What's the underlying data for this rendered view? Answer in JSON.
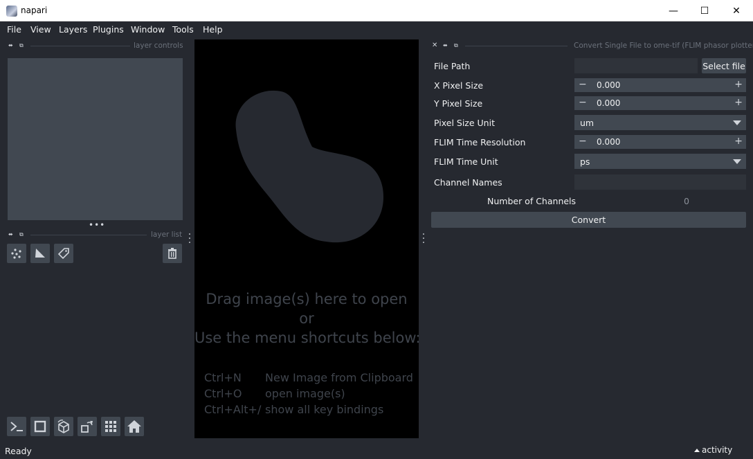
{
  "window": {
    "title": "napari",
    "min_glyph": "—",
    "max_glyph": "☐",
    "close_glyph": "✕"
  },
  "menu": [
    "File",
    "View",
    "Layers",
    "Plugins",
    "Window",
    "Tools",
    "Help"
  ],
  "layer_controls": {
    "title": "layer controls"
  },
  "layer_list": {
    "title": "layer list"
  },
  "layer_buttons": [
    {
      "name": "new-points-layer-button",
      "icon": "points-icon"
    },
    {
      "name": "new-shapes-layer-button",
      "icon": "shapes-icon"
    },
    {
      "name": "new-labels-layer-button",
      "icon": "labels-icon"
    }
  ],
  "viewer_buttons": [
    {
      "name": "console-button",
      "icon": "console-icon"
    },
    {
      "name": "ndisplay-button",
      "icon": "square-icon"
    },
    {
      "name": "roll-dims-button",
      "icon": "cube-icon"
    },
    {
      "name": "transpose-dims-button",
      "icon": "transpose-icon"
    },
    {
      "name": "grid-view-button",
      "icon": "grid-icon"
    },
    {
      "name": "home-button",
      "icon": "home-icon"
    }
  ],
  "canvas": {
    "drop_line1": "Drag image(s) here to open",
    "drop_line2": "or",
    "drop_line3": "Use the menu shortcuts below:",
    "shortcuts": [
      {
        "key": "Ctrl+N",
        "desc": "New Image from Clipboard"
      },
      {
        "key": "Ctrl+O",
        "desc": "open image(s)"
      },
      {
        "key": "Ctrl+Alt+/",
        "desc": "show all key bindings"
      }
    ]
  },
  "plugin": {
    "title": "Convert Single File to ome-tif (FLIM phasor plotter)",
    "file_path_label": "File Path",
    "file_path_value": "",
    "select_file_label": "Select file",
    "x_pixel_label": "X Pixel Size",
    "x_pixel_value": "0.000",
    "y_pixel_label": "Y Pixel Size",
    "y_pixel_value": "0.000",
    "pixel_unit_label": "Pixel Size Unit",
    "pixel_unit_value": "um",
    "flim_res_label": "FLIM Time Resolution",
    "flim_res_value": "0.000",
    "flim_unit_label": "FLIM Time Unit",
    "flim_unit_value": "ps",
    "channel_names_label": "Channel Names",
    "channel_names_value": "",
    "num_channels_label": "Number of Channels",
    "num_channels_value": "0",
    "convert_label": "Convert"
  },
  "status": {
    "ready": "Ready",
    "activity": "activity"
  },
  "colors": {
    "background": "#262930",
    "panel": "#414851",
    "canvas": "#000000",
    "blob": "#262930"
  }
}
